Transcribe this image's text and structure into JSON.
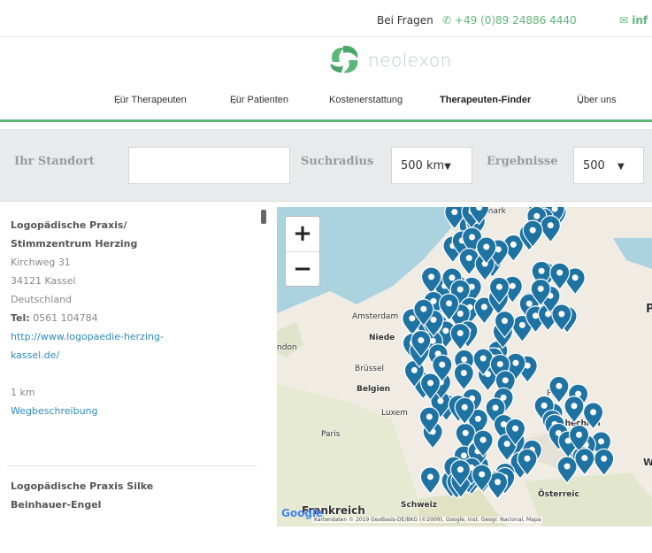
{
  "topbar": {
    "question": "Bei Fragen",
    "phone": "+49 (0)89 24886 4440",
    "email_fragment": "inf"
  },
  "brand": {
    "name": "neolexon",
    "color": "#5cb77a"
  },
  "nav": [
    {
      "label": "Für Therapeuten",
      "dropdown": true,
      "active": false
    },
    {
      "label": "Für Patienten",
      "dropdown": true,
      "active": false
    },
    {
      "label": "Kostenerstattung",
      "dropdown": false,
      "active": false
    },
    {
      "label": "Therapeuten-Finder",
      "dropdown": false,
      "active": true
    },
    {
      "label": "Über uns",
      "dropdown": true,
      "active": false
    }
  ],
  "search": {
    "location_label": "Ihr Standort",
    "location_value": "",
    "radius_label": "Suchradius",
    "radius_value": "500 km",
    "results_label": "Ergebnisse",
    "results_value": "500"
  },
  "results": [
    {
      "name_line1": "Logopädische Praxis/",
      "name_line2": "Stimmzentrum Herzing",
      "street": "Kirchweg 31",
      "city": "34121 Kassel",
      "country": "Deutschland",
      "tel_label": "Tel:",
      "tel": "0561 104784",
      "url_line1": "http://www.logopaedie-herzing-",
      "url_line2": "kassel.de/",
      "distance": "1 km",
      "directions": "Wegbeschreibung"
    },
    {
      "name_line1": "Logopädische Praxis Silke",
      "name_line2": "Beinhauer-Engel"
    }
  ],
  "map": {
    "zoom_in": "+",
    "zoom_out": "−",
    "labels": {
      "denmark": "Dänemark",
      "amsterdam": "Amsterdam",
      "niederlande": "Niede",
      "london": "ndon",
      "bruessel": "Brüssel",
      "belgien": "Belgien",
      "luxemburg": "Luxem",
      "paris": "Paris",
      "prag": "Prag",
      "tschechien": "Tschechien",
      "oesterreich": "Österreic",
      "schweiz": "Schweiz",
      "edge_p": "P",
      "edge_w": "W",
      "frankreich": "Frankreich"
    },
    "google": "Google",
    "attribution": "Kartendaten © 2019 GeoBasis-DE/BKG (©2009), Google, Inst. Geogr. Nacional, Mapa",
    "pin_color": "#1f73a3"
  },
  "icons": {
    "phone": "phone-icon",
    "mail": "mail-icon",
    "dropdown": "chevron-down-icon"
  }
}
